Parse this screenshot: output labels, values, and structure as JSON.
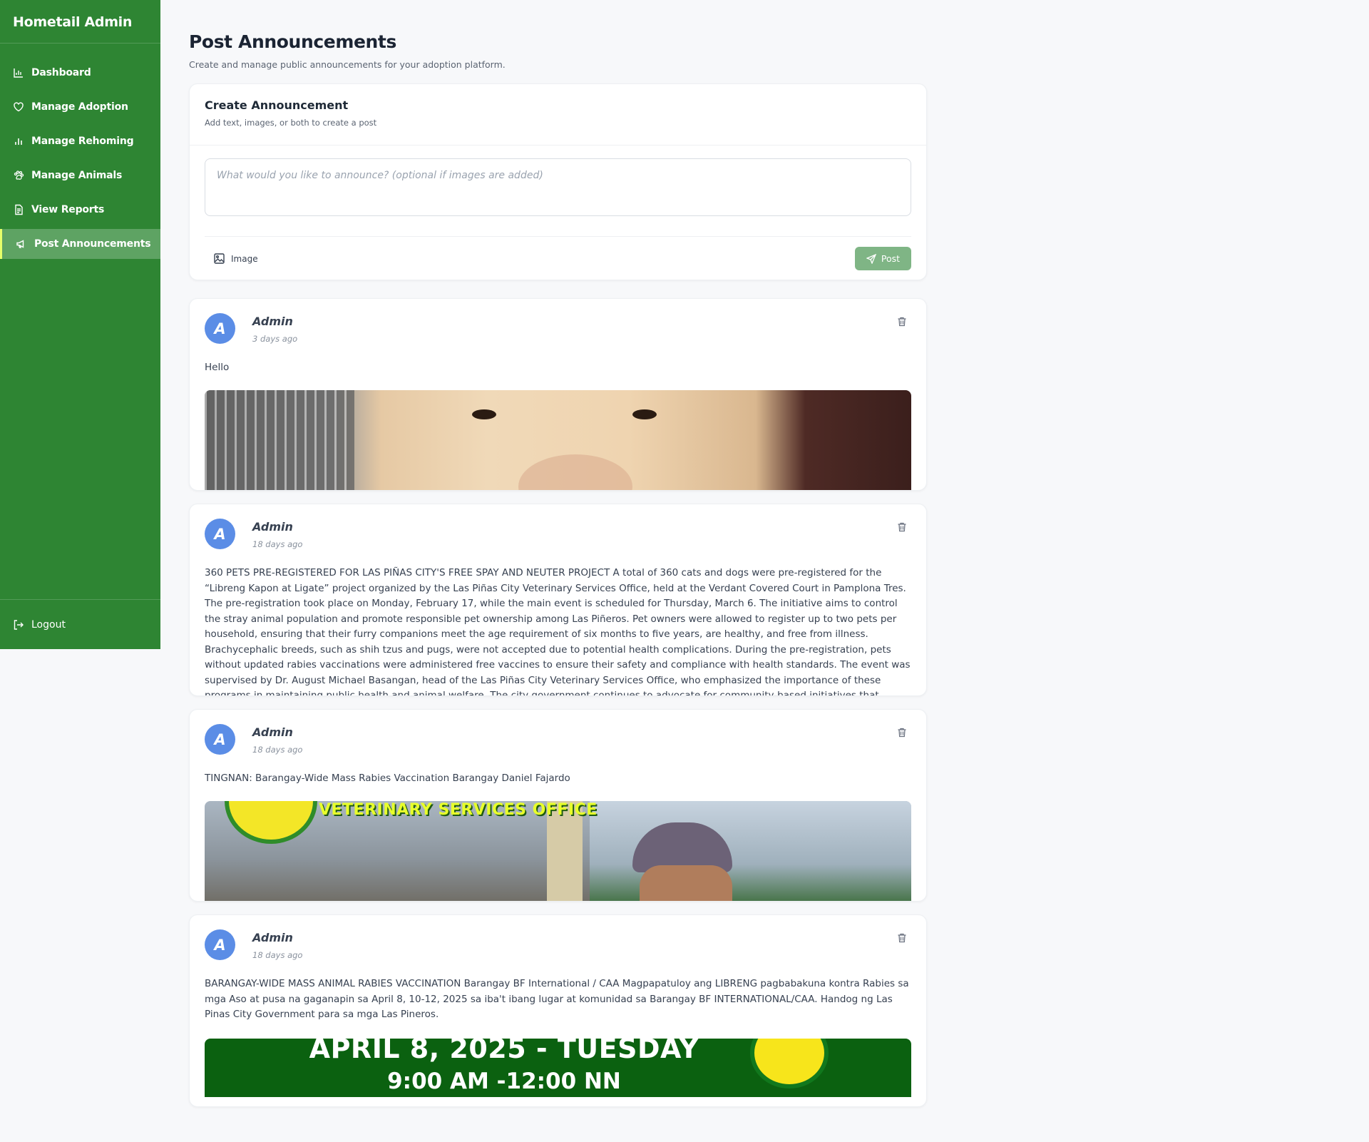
{
  "app": {
    "title": "Hometail Admin"
  },
  "sidebar": {
    "items": [
      {
        "label": "Dashboard",
        "icon": "chart-icon"
      },
      {
        "label": "Manage Adoption",
        "icon": "heart-icon"
      },
      {
        "label": "Manage Rehoming",
        "icon": "bar-chart-icon"
      },
      {
        "label": "Manage Animals",
        "icon": "paw-icon"
      },
      {
        "label": "View Reports",
        "icon": "document-icon"
      },
      {
        "label": "Post Announcements",
        "icon": "megaphone-icon",
        "active": true
      }
    ],
    "logout_label": "Logout"
  },
  "page": {
    "title": "Post Announcements",
    "subtitle": "Create and manage public announcements for your adoption platform."
  },
  "create": {
    "title": "Create Announcement",
    "subtitle": "Add text, images, or both to create a post",
    "placeholder": "What would you like to announce? (optional if images are added)",
    "image_label": "Image",
    "post_label": "Post"
  },
  "posts": [
    {
      "avatar": "A",
      "author": "Admin",
      "time": "3 days ago",
      "text": "Hello"
    },
    {
      "avatar": "A",
      "author": "Admin",
      "time": "18 days ago",
      "text": "360 PETS PRE-REGISTERED FOR LAS PIÑAS CITY'S FREE SPAY AND NEUTER PROJECT A total of 360 cats and dogs were pre-registered for the “Libreng Kapon at Ligate” project organized by the Las Piñas City Veterinary Services Office, held at the Verdant Covered Court in Pamplona Tres. The pre-registration took place on Monday, February 17, while the main event is scheduled for Thursday, March 6. The initiative aims to control the stray animal population and promote responsible pet ownership among Las Piñeros. Pet owners were allowed to register up to two pets per household, ensuring that their furry companions meet the age requirement of six months to five years, are healthy, and free from illness. Brachycephalic breeds, such as shih tzus and pugs, were not accepted due to potential health complications. During the pre-registration, pets without updated rabies vaccinations were administered free vaccines to ensure their safety and compliance with health standards. The event was supervised by Dr. August Michael Basangan, head of the Las Piñas City Veterinary Services Office, who emphasized the importance of these programs in maintaining public health and animal welfare. The city government continues to advocate for community-based initiatives that promote safe and humane pet"
    },
    {
      "avatar": "A",
      "author": "Admin",
      "time": "18 days ago",
      "text": "TINGNAN: Barangay-Wide Mass Rabies Vaccination Barangay Daniel Fajardo",
      "image_text": "VETERINARY SERVICES OFFICE"
    },
    {
      "avatar": "A",
      "author": "Admin",
      "time": "18 days ago",
      "text": "BARANGAY-WIDE MASS ANIMAL RABIES VACCINATION Barangay BF International / CAA Magpapatuloy ang LIBRENG pagbabakuna kontra Rabies sa mga Aso at pusa na gaganapin sa April 8, 10-12, 2025 sa iba't ibang lugar at komunidad sa Barangay BF INTERNATIONAL/CAA. Handog ng Las Pinas City Government para sa mga Las Pineros.",
      "image_text_1": "APRIL 8, 2025 - TUESDAY",
      "image_text_2": "9:00 AM -12:00 NN"
    }
  ],
  "colors": {
    "sidebar": "#2e8533",
    "sidebar_active": "#5ea363",
    "active_marker": "#e6ff6a",
    "post_button": "#7fb585",
    "avatar": "#5b8de6"
  }
}
